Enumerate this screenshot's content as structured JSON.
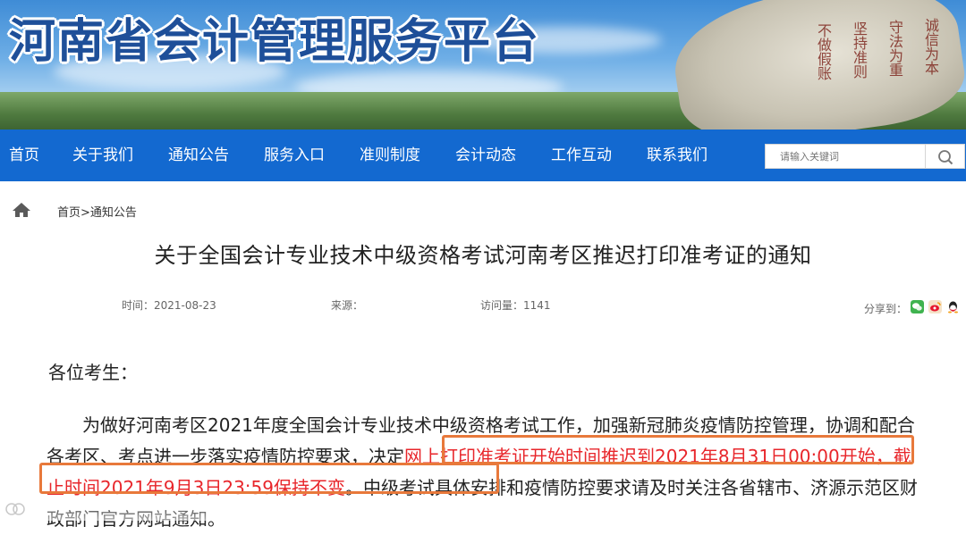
{
  "banner": {
    "site_title": "河南省会计管理服务平台",
    "carving": [
      "诚信为本",
      "守法为重",
      "坚持准则",
      "不做假账"
    ]
  },
  "nav": {
    "items": [
      "首页",
      "关于我们",
      "通知公告",
      "服务入口",
      "准则制度",
      "会计动态",
      "工作互动",
      "联系我们"
    ],
    "search_placeholder": "请输入关键词",
    "bg_color": "#1369d0"
  },
  "breadcrumb": {
    "text": "首页>通知公告"
  },
  "article": {
    "title": "关于全国会计专业技术中级资格考试河南考区推迟打印准考证的通知",
    "time": "时间：2021-08-23",
    "source": "来源：",
    "views": "访问量：1141",
    "share_label": "分享到：",
    "greeting": "各位考生：",
    "para_part1": "为做好河南考区2021年度全国会计专业技术中级资格考试工作，加强新冠肺炎疫情防控管理，协调和配合各考区、考点进一步落实疫情防控要求，决定",
    "para_highlight": "网上打印准考证开始时间推迟到2021年8月31日00:00开始，截止时间2021年9月3日23:59保持不变",
    "para_part2": "。中级考试具体安排和疫情防控要求请及时关注各省辖市、济源示范区财政部门官方网站通知。",
    "highlight_color": "#e8262b",
    "box_color": "#e8793b"
  }
}
